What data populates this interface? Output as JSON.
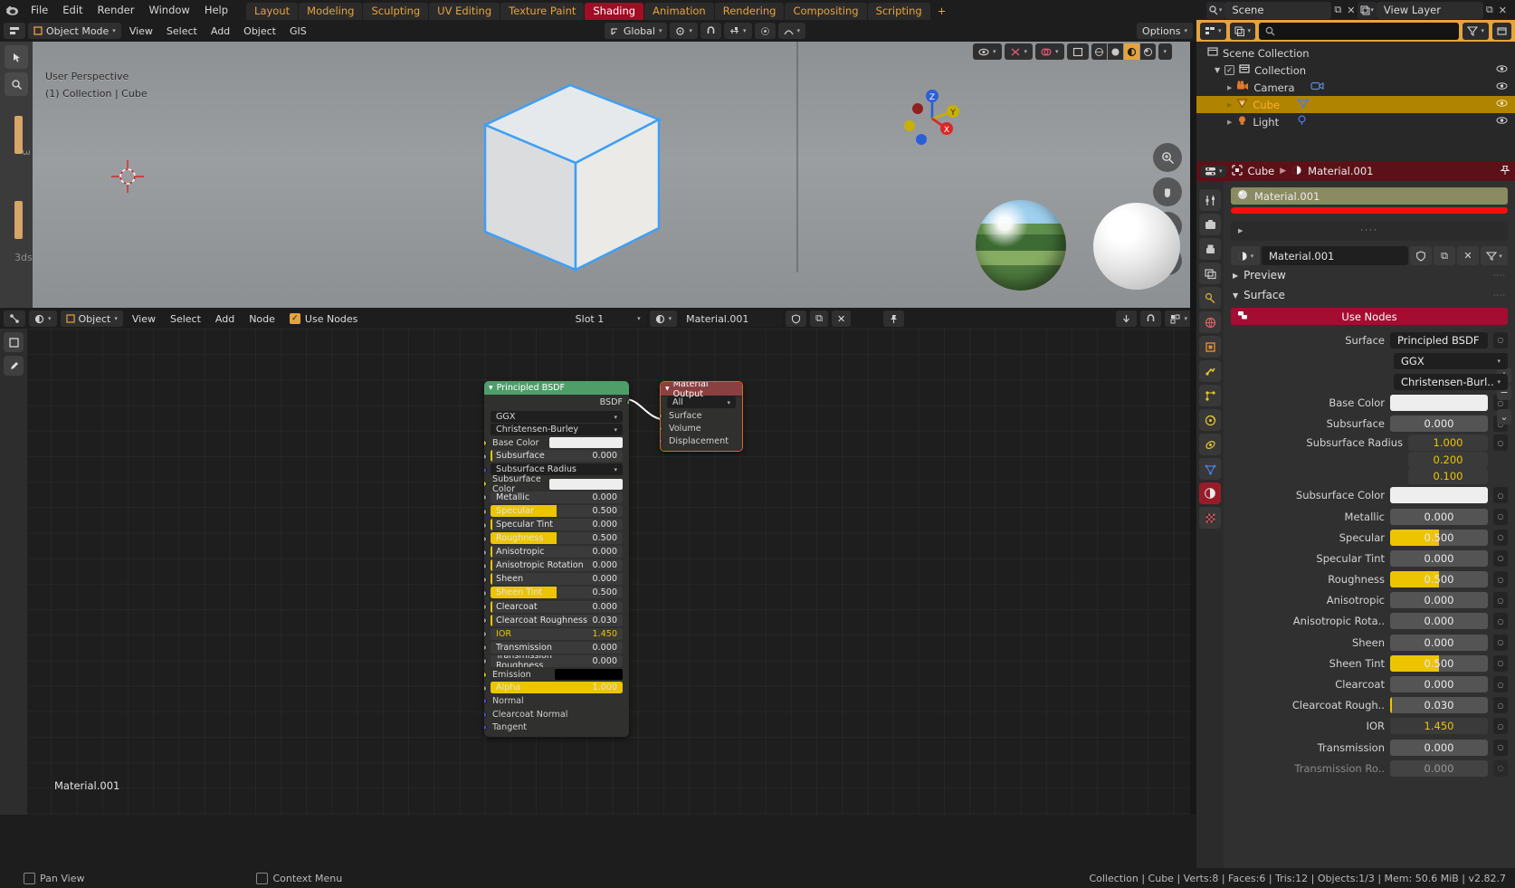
{
  "app": {
    "version": "v2.82.7",
    "logo_icon": "blender-logo"
  },
  "topbar": {
    "menus": [
      "File",
      "Edit",
      "Render",
      "Window",
      "Help"
    ],
    "workspace_tabs": [
      {
        "label": "Layout",
        "active": false
      },
      {
        "label": "Modeling",
        "active": false
      },
      {
        "label": "Sculpting",
        "active": false
      },
      {
        "label": "UV Editing",
        "active": false
      },
      {
        "label": "Texture Paint",
        "active": false
      },
      {
        "label": "Shading",
        "active": true
      },
      {
        "label": "Animation",
        "active": false
      },
      {
        "label": "Rendering",
        "active": false
      },
      {
        "label": "Compositing",
        "active": false
      },
      {
        "label": "Scripting",
        "active": false
      }
    ],
    "add_workspace_label": "+",
    "scene_name": "Scene",
    "view_layer_name": "View Layer",
    "scene_icon": "scene-icon",
    "viewlayer_icon": "view-layer-icon",
    "copy_icon": "duplicate-icon",
    "close_icon": "x-icon"
  },
  "viewport_header": {
    "mode": "Object Mode",
    "menus": [
      "View",
      "Select",
      "Add",
      "Object",
      "GIS"
    ],
    "transform_orientation": "Global",
    "options_label": "Options",
    "editor_type_icon": "editor-type-icon",
    "select_mode_icon": "select-box-icon",
    "cursor_icon": "cursor-icon",
    "snap_icon": "magnet-icon",
    "proportional_icon": "proportional-edit-icon",
    "pivot_icon": "pivot-icon"
  },
  "viewport": {
    "perspective_label": "User Perspective",
    "collection_label": "(1) Collection | Cube",
    "gizmo_axes": [
      "Z",
      "Y",
      "X"
    ],
    "shading_modes": [
      "wireframe",
      "solid",
      "material-preview",
      "rendered"
    ],
    "active_shading": "material-preview",
    "side_labels": [
      "3",
      "3ds"
    ]
  },
  "shader_editor": {
    "editor_type_icon": "shader-editor-icon",
    "shader_type": "Object",
    "menus": [
      "View",
      "Select",
      "Add",
      "Node"
    ],
    "use_nodes_label": "Use Nodes",
    "use_nodes_checked": true,
    "slot": "Slot 1",
    "material_name": "Material.001",
    "footer_label": "Material.001",
    "fake_user_icon": "shield-icon",
    "new_material_icon": "duplicate-icon",
    "unlink_icon": "x-icon",
    "pin_icon": "pin-icon",
    "snap_icon": "snap-icon",
    "overlay_icon": "overlay-icon"
  },
  "nodes": {
    "principled": {
      "title": "Principled BSDF",
      "header_color": "#4f9d69",
      "output_socket": "BSDF",
      "distribution": "GGX",
      "subsurface_method": "Christensen-Burley",
      "inputs": [
        {
          "label": "Base Color",
          "type": "color",
          "value": "#eeeeee",
          "socket": "#ccc520"
        },
        {
          "label": "Subsurface",
          "type": "slider",
          "value": "0.000",
          "fill": 0,
          "socket": "#a0a0a0",
          "bar": true
        },
        {
          "label": "Subsurface Radius",
          "type": "dropdown",
          "value": "",
          "socket": "#5050dd"
        },
        {
          "label": "Subsurface Color",
          "type": "color",
          "value": "#eeeeee",
          "socket": "#ccc520"
        },
        {
          "label": "Metallic",
          "type": "slider",
          "value": "0.000",
          "fill": 0,
          "socket": "#a0a0a0"
        },
        {
          "label": "Specular",
          "type": "slider",
          "value": "0.500",
          "fill": 50,
          "socket": "#a0a0a0"
        },
        {
          "label": "Specular Tint",
          "type": "slider",
          "value": "0.000",
          "fill": 0,
          "socket": "#a0a0a0",
          "bar": true
        },
        {
          "label": "Roughness",
          "type": "slider",
          "value": "0.500",
          "fill": 50,
          "socket": "#a0a0a0"
        },
        {
          "label": "Anisotropic",
          "type": "slider",
          "value": "0.000",
          "fill": 0,
          "socket": "#a0a0a0",
          "bar": true
        },
        {
          "label": "Anisotropic Rotation",
          "type": "slider",
          "value": "0.000",
          "fill": 0,
          "socket": "#a0a0a0",
          "bar": true
        },
        {
          "label": "Sheen",
          "type": "slider",
          "value": "0.000",
          "fill": 0,
          "socket": "#a0a0a0",
          "bar": true
        },
        {
          "label": "Sheen Tint",
          "type": "slider",
          "value": "0.500",
          "fill": 50,
          "socket": "#a0a0a0"
        },
        {
          "label": "Clearcoat",
          "type": "slider",
          "value": "0.000",
          "fill": 0,
          "socket": "#a0a0a0",
          "bar": true
        },
        {
          "label": "Clearcoat Roughness",
          "type": "slider",
          "value": "0.030",
          "fill": 0,
          "socket": "#a0a0a0",
          "bar": true
        },
        {
          "label": "IOR",
          "type": "yellowtext",
          "value": "1.450",
          "socket": "#a0a0a0"
        },
        {
          "label": "Transmission",
          "type": "slider",
          "value": "0.000",
          "fill": 0,
          "socket": "#a0a0a0"
        },
        {
          "label": "Transmission Roughness",
          "type": "slider",
          "value": "0.000",
          "fill": 0,
          "socket": "#a0a0a0"
        },
        {
          "label": "Emission",
          "type": "color",
          "value": "#000000",
          "socket": "#ccc520"
        },
        {
          "label": "Alpha",
          "type": "slider",
          "value": "1.000",
          "fill": 100,
          "socket": "#a0a0a0"
        },
        {
          "label": "Normal",
          "type": "none",
          "value": "",
          "socket": "#5050dd"
        },
        {
          "label": "Clearcoat Normal",
          "type": "none",
          "value": "",
          "socket": "#5050dd"
        },
        {
          "label": "Tangent",
          "type": "none",
          "value": "",
          "socket": "#5050dd"
        }
      ]
    },
    "material_output": {
      "title": "Material Output",
      "header_color": "#8a4040",
      "target": "All",
      "inputs": [
        {
          "label": "Surface",
          "socket": "#4f9d69"
        },
        {
          "label": "Volume",
          "socket": "#4f9d69"
        },
        {
          "label": "Displacement",
          "socket": "#5050dd"
        }
      ]
    }
  },
  "outliner": {
    "search_placeholder": "",
    "display_mode_icon": "outliner-display-icon",
    "filter_icon": "filter-icon",
    "items": [
      {
        "label": "Scene Collection",
        "icon": "collection-icon",
        "depth": 0,
        "selected": false,
        "eye": false,
        "checkbox": false
      },
      {
        "label": "Collection",
        "icon": "collection-icon",
        "depth": 1,
        "selected": false,
        "eye": true,
        "checkbox": true
      },
      {
        "label": "Camera",
        "icon": "camera-icon",
        "depth": 2,
        "selected": false,
        "eye": true,
        "checkbox": false,
        "data_icon": "camera-data-icon"
      },
      {
        "label": "Cube",
        "icon": "mesh-icon",
        "depth": 2,
        "selected": true,
        "eye": true,
        "checkbox": false,
        "data_icon": "mesh-data-icon"
      },
      {
        "label": "Light",
        "icon": "light-icon",
        "depth": 2,
        "selected": false,
        "eye": true,
        "checkbox": false,
        "data_icon": "light-data-icon"
      }
    ]
  },
  "properties": {
    "breadcrumb": [
      "Cube",
      "Material.001"
    ],
    "breadcrumb_object_icon": "object-icon",
    "breadcrumb_material_icon": "material-icon",
    "pin_icon": "pin-icon",
    "material_slot": "Material.001",
    "slot_color": "#f0110f",
    "material_datablock": "Material.001",
    "add_slot_label": "+",
    "remove_slot_label": "−",
    "menu_label": "v",
    "sections": [
      {
        "label": "Preview",
        "expanded": false
      },
      {
        "label": "Surface",
        "expanded": true
      }
    ],
    "use_nodes_label": "Use Nodes",
    "surface_label": "Surface",
    "surface_value": "Principled BSDF",
    "distribution": "GGX",
    "subsurface_method": "Christensen-Burl..",
    "fields": [
      {
        "label": "Base Color",
        "type": "color",
        "value": "#efefef"
      },
      {
        "label": "Subsurface",
        "type": "num",
        "value": "0.000",
        "fill": 0
      },
      {
        "label": "Subsurface Radius",
        "type": "multi",
        "values": [
          "1.000",
          "0.200",
          "0.100"
        ]
      },
      {
        "label": "Subsurface Color",
        "type": "color",
        "value": "#efefef"
      },
      {
        "label": "Metallic",
        "type": "num",
        "value": "0.000",
        "fill": 0
      },
      {
        "label": "Specular",
        "type": "num",
        "value": "0.500",
        "fill": 50
      },
      {
        "label": "Specular Tint",
        "type": "num",
        "value": "0.000",
        "fill": 0
      },
      {
        "label": "Roughness",
        "type": "num",
        "value": "0.500",
        "fill": 50
      },
      {
        "label": "Anisotropic",
        "type": "num",
        "value": "0.000",
        "fill": 0
      },
      {
        "label": "Anisotropic Rota..",
        "type": "num",
        "value": "0.000",
        "fill": 0
      },
      {
        "label": "Sheen",
        "type": "num",
        "value": "0.000",
        "fill": 0
      },
      {
        "label": "Sheen Tint",
        "type": "num",
        "value": "0.500",
        "fill": 50
      },
      {
        "label": "Clearcoat",
        "type": "num",
        "value": "0.000",
        "fill": 0
      },
      {
        "label": "Clearcoat Rough..",
        "type": "num",
        "value": "0.030",
        "fill": 0,
        "edge": true
      },
      {
        "label": "IOR",
        "type": "yellow",
        "value": "1.450"
      },
      {
        "label": "Transmission",
        "type": "num",
        "value": "0.000",
        "fill": 0
      },
      {
        "label": "Transmission Ro..",
        "type": "num",
        "value": "0.000",
        "fill": 0
      }
    ],
    "tab_icons": [
      "tool-icon",
      "render-icon",
      "output-icon",
      "view-layer-icon",
      "scene-icon",
      "world-icon",
      "object-icon",
      "modifier-icon",
      "particles-icon",
      "physics-icon",
      "constraints-icon",
      "data-icon",
      "material-icon",
      "texture-icon"
    ]
  },
  "statusbar": {
    "items": [
      {
        "key": "mouse-middle",
        "label": "Pan View"
      },
      {
        "key": "mouse-right",
        "label": "Context Menu"
      }
    ],
    "stats": "Collection | Cube | Verts:8 | Faces:6 | Tris:12 | Objects:1/3 | Mem: 50.6 MiB | v2.82.7"
  }
}
